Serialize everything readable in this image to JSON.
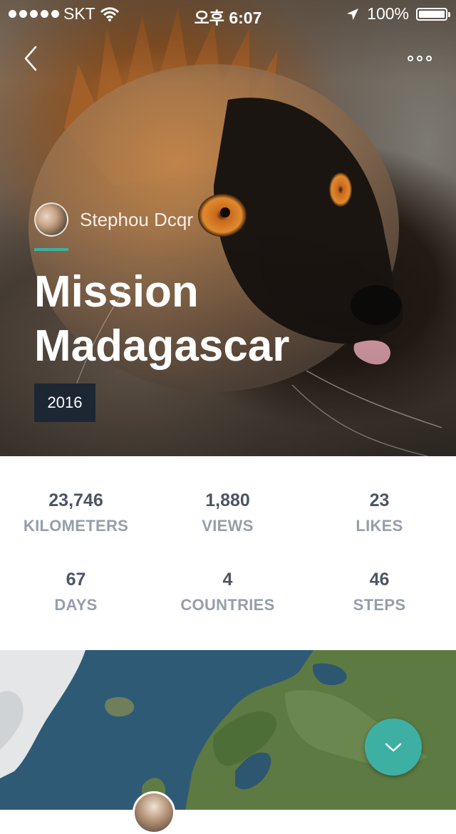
{
  "status_bar": {
    "carrier": "SKT",
    "time": "오후 6:07",
    "battery": "100%",
    "signal_bars": 5
  },
  "nav": {
    "back_icon": "chevron-left-icon",
    "more_icon": "more-horizontal-icon"
  },
  "trip": {
    "author": "Stephou Dcqr",
    "title_line1": "Mission",
    "title_line2": "Madagascar",
    "year": "2016"
  },
  "stats": [
    {
      "value": "23,746",
      "label": "KILOMETERS"
    },
    {
      "value": "1,880",
      "label": "VIEWS"
    },
    {
      "value": "23",
      "label": "LIKES"
    },
    {
      "value": "67",
      "label": "DAYS"
    },
    {
      "value": "4",
      "label": "COUNTRIES"
    },
    {
      "value": "46",
      "label": "STEPS"
    }
  ],
  "fab": {
    "icon": "chevron-down-icon"
  },
  "colors": {
    "accent": "#39b1a1",
    "fab": "#3eb0a3",
    "badge_bg": "#1d2633",
    "stat_value": "#4c5563",
    "stat_label": "#959eaa"
  }
}
